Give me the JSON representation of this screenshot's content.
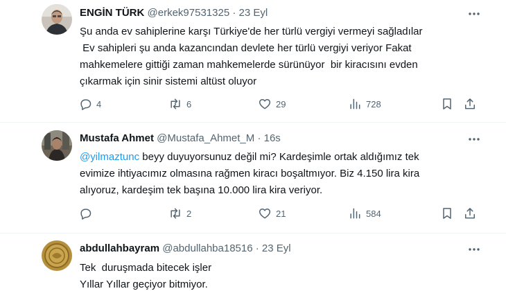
{
  "tweets": [
    {
      "author": "ENGİN TÜRK",
      "handle": "@erkek97531325",
      "separator": "·",
      "time": "23 Eyl",
      "text_lines": [
        "Şu anda ev sahiplerine karşı Türkiye'de her türlü vergiyi vermeyi sağladılar",
        " Ev sahipleri şu anda kazancından devlete her türlü vergiyi veriyor Fakat",
        "mahkemelere gittiği zaman mahkemelerde sürünüyor  bir kiracısını evden",
        "çıkarmak için sinir sistemi altüst oluyor"
      ],
      "replies": "4",
      "retweets": "6",
      "likes": "29",
      "views": "728"
    },
    {
      "author": "Mustafa Ahmet",
      "handle": "@Mustafa_Ahmet_M",
      "separator": "·",
      "time": "16s",
      "mention": "@yilmaztunc",
      "text_lines": [
        " beyy duyuyorsunuz değil mi? Kardeşimle ortak aldığımız tek",
        "evimize ihtiyacımız olmasına rağmen kiracı boşaltmıyor. Biz 4.150 lira kira",
        "alıyoruz, kardeşim tek başına 10.000 lira kira veriyor."
      ],
      "replies": "",
      "retweets": "2",
      "likes": "21",
      "views": "584"
    },
    {
      "author": "abdullahbayram",
      "handle": "@abdullahba18516",
      "separator": "·",
      "time": "23 Eyl",
      "text_lines": [
        "Tek  duruşmada bitecek işler",
        "Yıllar Yıllar geçiyor bitmiyor."
      ]
    }
  ],
  "icons": {
    "more": "more-horizontal-icon",
    "reply": "reply-icon",
    "retweet": "retweet-icon",
    "like": "heart-icon",
    "views": "views-icon",
    "bookmark": "bookmark-icon",
    "share": "share-icon"
  },
  "colors": {
    "text": "#0f1419",
    "secondary": "#536471",
    "link": "#1d9bf0",
    "divider": "#eff3f4"
  }
}
